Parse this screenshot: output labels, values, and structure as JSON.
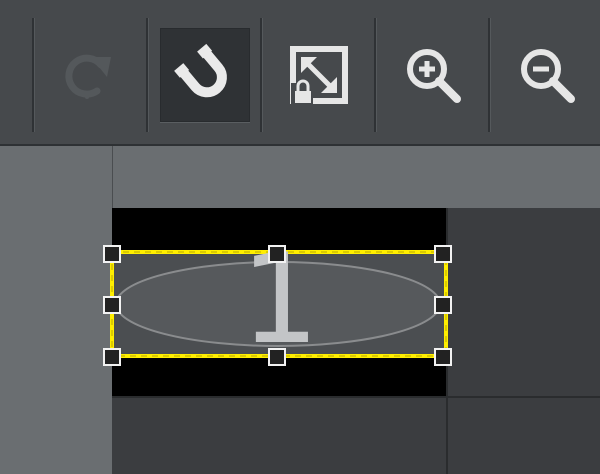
{
  "toolbar": {
    "buttons": [
      {
        "name": "redo",
        "icon": "redo-icon",
        "enabled": false
      },
      {
        "name": "snap",
        "icon": "magnet-icon",
        "active": true
      },
      {
        "name": "fit",
        "icon": "fit-to-screen-lock-icon"
      },
      {
        "name": "zoom-in",
        "icon": "zoom-in-icon"
      },
      {
        "name": "zoom-out",
        "icon": "zoom-out-icon"
      }
    ]
  },
  "canvas": {
    "selected_shape": {
      "type": "ellipse",
      "label": "1",
      "selection_color": "#ffee00"
    }
  },
  "colors": {
    "toolbar_bg": "#46494c",
    "active_button_bg": "#2f3235",
    "ruler_bg": "#6a6e71",
    "canvas_bg": "#3b3d40",
    "cell_bg": "#000000"
  }
}
